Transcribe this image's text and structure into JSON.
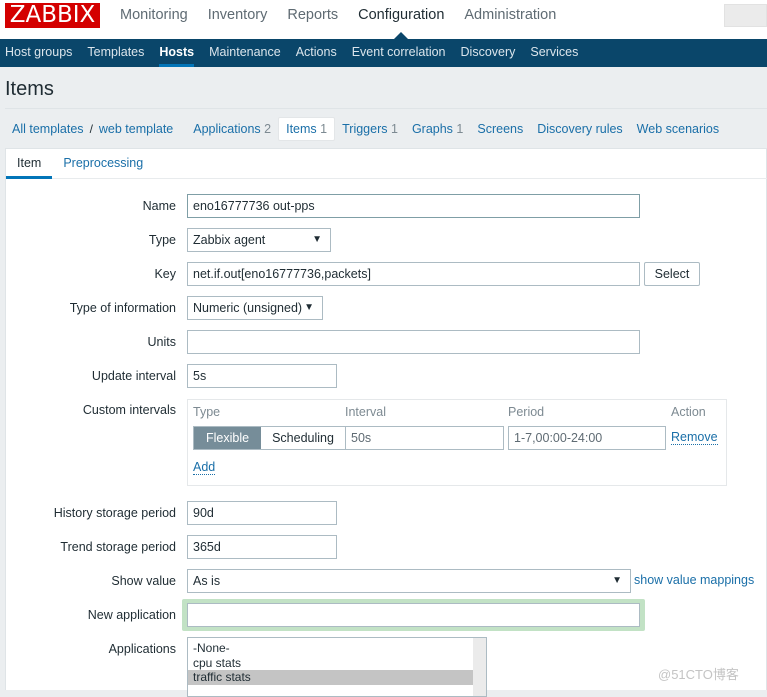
{
  "logo": "ZABBIX",
  "top_menu": [
    {
      "label": "Monitoring",
      "active": false
    },
    {
      "label": "Inventory",
      "active": false
    },
    {
      "label": "Reports",
      "active": false
    },
    {
      "label": "Configuration",
      "active": true
    },
    {
      "label": "Administration",
      "active": false
    }
  ],
  "sub_menu": [
    {
      "label": "Host groups",
      "active": false
    },
    {
      "label": "Templates",
      "active": false
    },
    {
      "label": "Hosts",
      "active": true
    },
    {
      "label": "Maintenance",
      "active": false
    },
    {
      "label": "Actions",
      "active": false
    },
    {
      "label": "Event correlation",
      "active": false
    },
    {
      "label": "Discovery",
      "active": false
    },
    {
      "label": "Services",
      "active": false
    }
  ],
  "page_title": "Items",
  "breadcrumb": {
    "all_templates": "All templates",
    "separator": "/",
    "template": "web template"
  },
  "nav_links": [
    {
      "label": "Applications",
      "count": "2"
    },
    {
      "label": "Items",
      "count": "1",
      "active": true
    },
    {
      "label": "Triggers",
      "count": "1"
    },
    {
      "label": "Graphs",
      "count": "1"
    },
    {
      "label": "Screens",
      "count": ""
    },
    {
      "label": "Discovery rules",
      "count": ""
    },
    {
      "label": "Web scenarios",
      "count": ""
    }
  ],
  "tabs": [
    {
      "label": "Item",
      "active": true
    },
    {
      "label": "Preprocessing",
      "active": false
    }
  ],
  "form": {
    "name": {
      "label": "Name",
      "value": "eno16777736 out-pps"
    },
    "type": {
      "label": "Type",
      "value": "Zabbix agent"
    },
    "key": {
      "label": "Key",
      "value": "net.if.out[eno16777736,packets]",
      "button": "Select"
    },
    "type_of_information": {
      "label": "Type of information",
      "value": "Numeric (unsigned)"
    },
    "units": {
      "label": "Units",
      "value": ""
    },
    "update_interval": {
      "label": "Update interval",
      "value": "5s"
    },
    "custom_intervals": {
      "label": "Custom intervals",
      "headers": {
        "type": "Type",
        "interval": "Interval",
        "period": "Period",
        "action": "Action"
      },
      "rows": [
        {
          "type_options": [
            "Flexible",
            "Scheduling"
          ],
          "selected": "Flexible",
          "interval": "50s",
          "period": "1-7,00:00-24:00",
          "action": "Remove"
        }
      ],
      "add": "Add"
    },
    "history": {
      "label": "History storage period",
      "value": "90d"
    },
    "trend": {
      "label": "Trend storage period",
      "value": "365d"
    },
    "show_value": {
      "label": "Show value",
      "value": "As is",
      "link": "show value mappings"
    },
    "new_application": {
      "label": "New application",
      "value": ""
    },
    "applications": {
      "label": "Applications",
      "options": [
        "-None-",
        "cpu stats",
        "traffic stats"
      ],
      "selected": "traffic stats"
    }
  },
  "arrow_glyph": "▼",
  "watermark": "@51CTO博客"
}
